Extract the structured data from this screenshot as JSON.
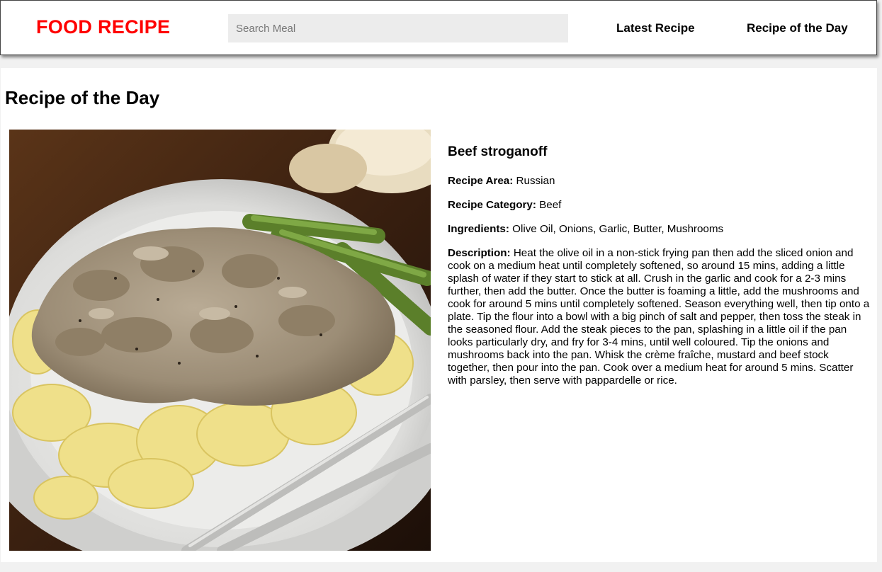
{
  "header": {
    "brand": "FOOD RECIPE",
    "search_placeholder": "Search Meal",
    "search_value": "",
    "nav": {
      "latest": "Latest Recipe",
      "day": "Recipe of the Day"
    }
  },
  "main": {
    "section_title": "Recipe of the Day",
    "meal": {
      "image_icon": "beef-stroganoff-photo",
      "name": "Beef stroganoff",
      "area_label": "Recipe Area:",
      "area": "Russian",
      "category_label": "Recipe Category:",
      "category": "Beef",
      "ingredients_label": "Ingredients:",
      "ingredients": "Olive Oil, Onions, Garlic, Butter, Mushrooms",
      "description_label": "Description:",
      "description": "Heat the olive oil in a non-stick frying pan then add the sliced onion and cook on a medium heat until completely softened, so around 15 mins, adding a little splash of water if they start to stick at all. Crush in the garlic and cook for a 2-3 mins further, then add the butter. Once the butter is foaming a little, add the mushrooms and cook for around 5 mins until completely softened. Season everything well, then tip onto a plate. Tip the flour into a bowl with a big pinch of salt and pepper, then toss the steak in the seasoned flour. Add the steak pieces to the pan, splashing in a little oil if the pan looks particularly dry, and fry for 3-4 mins, until well coloured. Tip the onions and mushrooms back into the pan. Whisk the crème fraîche, mustard and beef stock together, then pour into the pan. Cook over a medium heat for around 5 mins. Scatter with parsley, then serve with pappardelle or rice."
    }
  },
  "colors": {
    "brand": "#ff0000",
    "page_bg": "#f1f1f1",
    "search_bg": "#ececec"
  }
}
